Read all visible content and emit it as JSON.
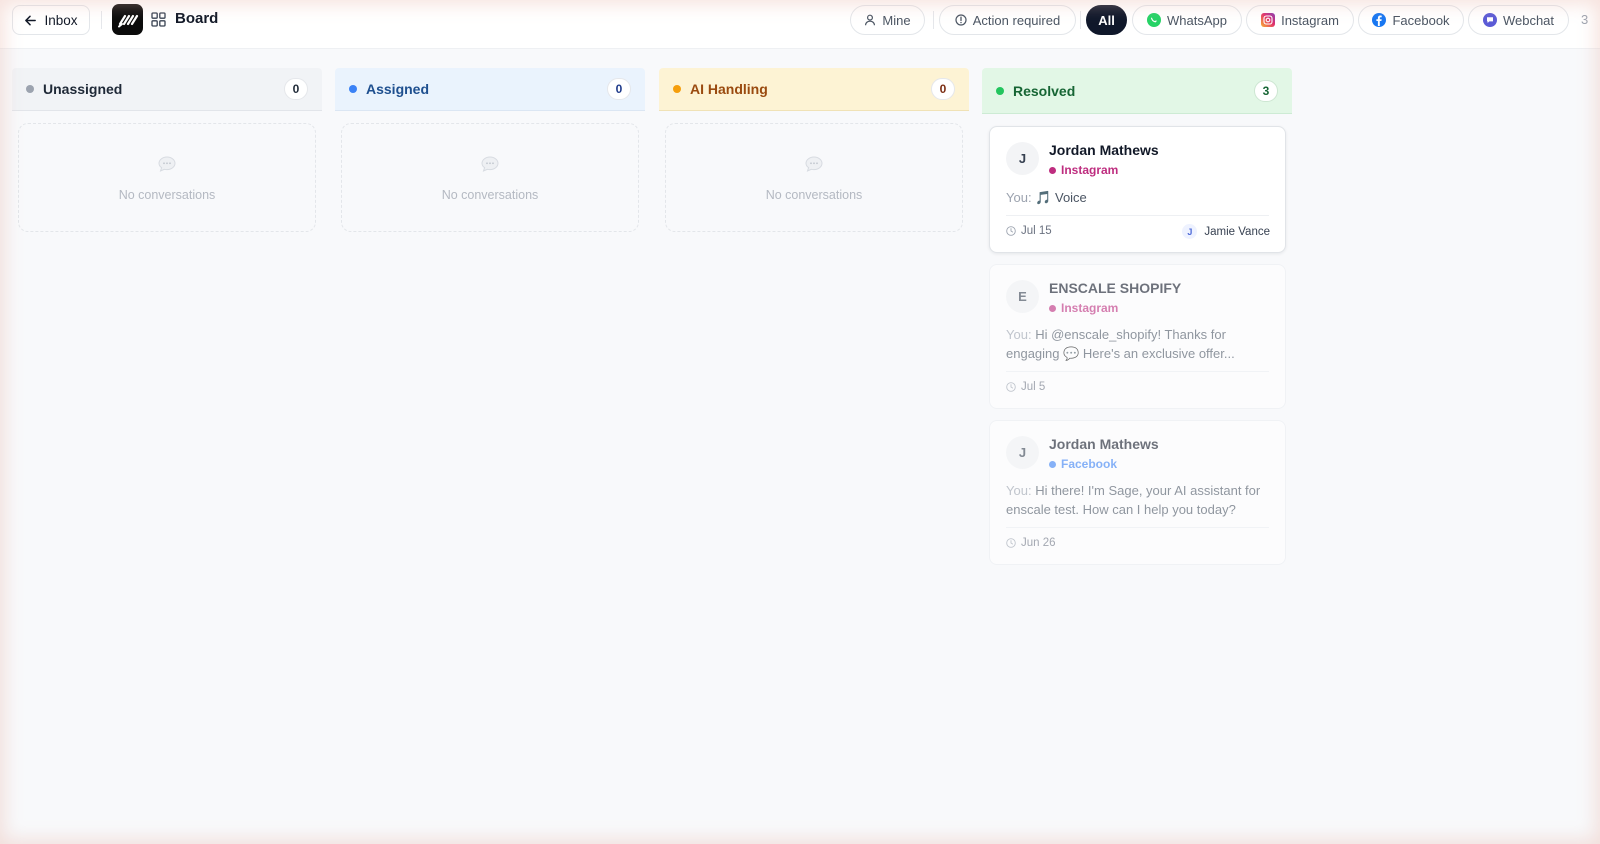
{
  "topbar": {
    "back_label": "Inbox",
    "title": "Board",
    "filters": {
      "mine": "Mine",
      "action_required": "Action required",
      "all": "All",
      "whatsapp": "WhatsApp",
      "instagram": "Instagram",
      "facebook": "Facebook",
      "webchat": "Webchat"
    },
    "overflow_count": "3",
    "active_filter": "All"
  },
  "columns": [
    {
      "title": "Unassigned",
      "count": "0",
      "empty_text": "No conversations",
      "accent": "#9ca3af"
    },
    {
      "title": "Assigned",
      "count": "0",
      "empty_text": "No conversations",
      "accent": "#3b82f6"
    },
    {
      "title": "AI Handling",
      "count": "0",
      "empty_text": "No conversations",
      "accent": "#f59e0b"
    },
    {
      "title": "Resolved",
      "count": "3",
      "accent": "#22c55e"
    }
  ],
  "cards": [
    {
      "initial": "J",
      "name": "Jordan Mathews",
      "channel": "Instagram",
      "preview_prefix": "You:",
      "preview": "🎵 Voice",
      "date": "Jul 15",
      "assignee_initial": "J",
      "assignee": "Jamie Vance"
    },
    {
      "initial": "E",
      "name": "ENSCALE SHOPIFY",
      "channel": "Instagram",
      "preview_prefix": "You:",
      "preview": "Hi @enscale_shopify! Thanks for engaging 💬 Here's an exclusive offer...",
      "date": "Jul 5"
    },
    {
      "initial": "J",
      "name": "Jordan Mathews",
      "channel": "Facebook",
      "preview_prefix": "You:",
      "preview": "Hi there! I'm Sage, your AI assistant for enscale test. How can I help you today?",
      "date": "Jun 26"
    }
  ],
  "colors": {
    "instagram": "#be2d7f",
    "facebook": "#3b82f6",
    "whatsapp": "#22c55e",
    "webchat": "#4f46e5",
    "unassigned_bg": "#f1f3f6",
    "assigned_bg": "#eaf3fd",
    "ai_bg": "#fdf3d4",
    "resolved_bg": "#e2f7e6"
  },
  "icons": {
    "back": "arrow-left-icon",
    "board": "grid-icon",
    "mine": "user-icon",
    "action_required": "alert-circle-icon",
    "empty": "chat-bubble-icon",
    "date": "clock-icon"
  }
}
